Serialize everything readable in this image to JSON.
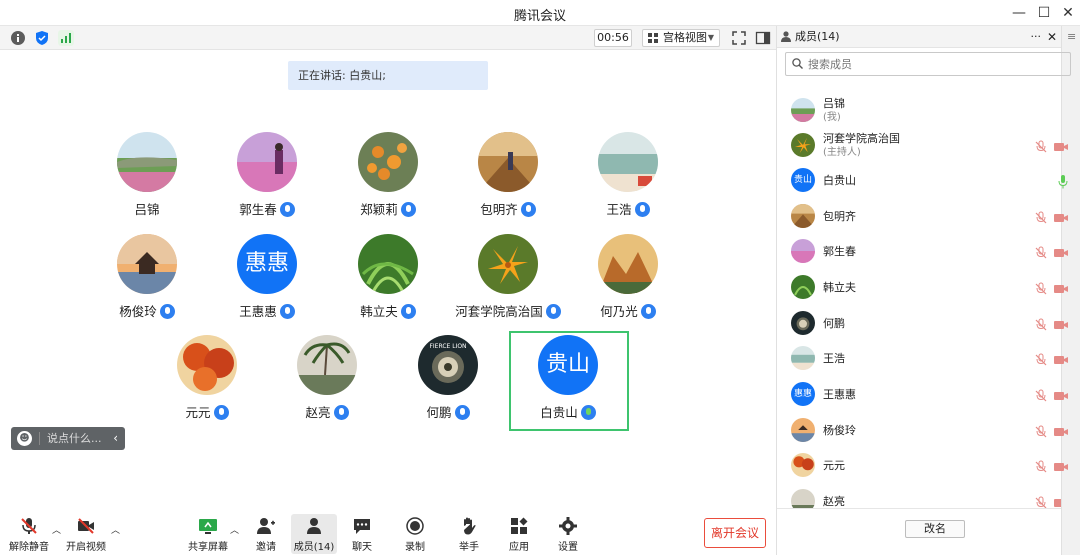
{
  "window": {
    "title": "腾讯会议",
    "controls": {
      "minimize": "—",
      "maximize": "☐",
      "close": "✕"
    }
  },
  "topbar": {
    "timer": "00:56",
    "view_label": "宫格视图",
    "icons": [
      "info-icon",
      "shield-icon",
      "signal-icon",
      "fullscreen-icon",
      "sidebar-toggle-icon"
    ]
  },
  "speaking_text": "正在讲话: 白贵山;",
  "tiles": [
    {
      "name": "吕锦",
      "mic": false,
      "avatar": "photo-landscape"
    },
    {
      "name": "郭生春",
      "mic": true,
      "avatar": "photo-flowers-pink"
    },
    {
      "name": "郑颖莉",
      "mic": true,
      "avatar": "photo-orange-berries"
    },
    {
      "name": "包明齐",
      "mic": true,
      "avatar": "photo-bridge-person"
    },
    {
      "name": "王浩",
      "mic": true,
      "avatar": "photo-beach"
    },
    {
      "name": "杨俊玲",
      "mic": true,
      "avatar": "photo-pavilion-sunset"
    },
    {
      "name": "王惠惠",
      "mic": true,
      "avatar_text": "惠惠"
    },
    {
      "name": "韩立夫",
      "mic": true,
      "avatar": "photo-green-fern"
    },
    {
      "name": "河套学院高治国",
      "mic": true,
      "avatar": "photo-orange-lily"
    },
    {
      "name": "何乃光",
      "mic": true,
      "avatar": "photo-rock-landscape"
    },
    {
      "name": "元元",
      "mic": true,
      "avatar": "photo-red-leaves"
    },
    {
      "name": "赵亮",
      "mic": true,
      "avatar": "photo-palm-trees"
    },
    {
      "name": "何鹏",
      "mic": true,
      "avatar": "logo-fierce-lion",
      "logo_text": "FIERCE LION"
    },
    {
      "name": "白贵山",
      "mic": true,
      "speaking": true,
      "avatar_text": "贵山"
    }
  ],
  "chat": {
    "placeholder": "说点什么..."
  },
  "toolbar": {
    "unmute": "解除静音",
    "start_video": "开启视频",
    "share_screen": "共享屏幕",
    "invite": "邀请",
    "members": "成员(14)",
    "chat": "聊天",
    "record": "录制",
    "raise_hand": "举手",
    "apps": "应用",
    "settings": "设置",
    "leave": "离开会议"
  },
  "panel": {
    "title": "成员(14)",
    "more": "···",
    "close": "✕",
    "side_menu": "≡",
    "search_placeholder": "搜索成员",
    "members": [
      {
        "name": "吕锦",
        "sub": "(我)",
        "avatar": "photo-landscape",
        "mic": "none"
      },
      {
        "name": "河套学院高治国",
        "sub": "(主持人)",
        "avatar": "photo-orange-lily",
        "mic": "muted"
      },
      {
        "name": "白贵山",
        "avatar_text": "贵山",
        "mic": "active"
      },
      {
        "name": "包明齐",
        "avatar": "photo-bridge-person",
        "mic": "muted"
      },
      {
        "name": "郭生春",
        "avatar": "photo-flowers-pink",
        "mic": "muted"
      },
      {
        "name": "韩立夫",
        "avatar": "photo-green-fern",
        "mic": "muted"
      },
      {
        "name": "何鹏",
        "avatar": "logo-fierce-lion",
        "mic": "muted"
      },
      {
        "name": "王浩",
        "avatar": "photo-beach",
        "mic": "muted"
      },
      {
        "name": "王惠惠",
        "avatar_text": "惠惠",
        "mic": "muted"
      },
      {
        "name": "杨俊玲",
        "avatar": "photo-pavilion-sunset",
        "mic": "muted"
      },
      {
        "name": "元元",
        "avatar": "photo-red-leaves",
        "mic": "muted"
      },
      {
        "name": "赵亮",
        "avatar": "photo-palm-trees",
        "mic": "muted"
      }
    ],
    "rename": "改名"
  },
  "colors": {
    "accent_blue": "#1173f6",
    "speaking_border": "#3ec46e",
    "leave_red": "#e2382a",
    "muted_icon": "#e58a86"
  }
}
